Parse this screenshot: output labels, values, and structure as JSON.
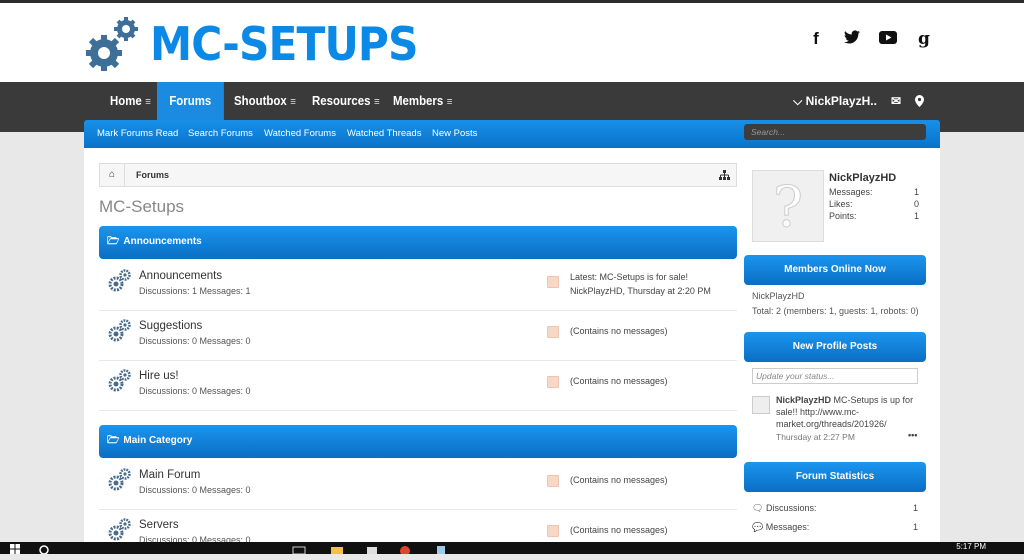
{
  "site": {
    "logo_text": "MC-SETUPS",
    "social_icons": [
      "facebook-icon",
      "twitter-icon",
      "youtube-icon",
      "google-plus-icon"
    ],
    "brand_color": "#0a8ae6"
  },
  "nav": {
    "items": [
      {
        "label": "Home",
        "active": false
      },
      {
        "label": "Forums",
        "active": true
      },
      {
        "label": "Shoutbox",
        "active": false
      },
      {
        "label": "Resources",
        "active": false
      },
      {
        "label": "Members",
        "active": false
      }
    ],
    "user": "NickPlayzH.."
  },
  "subnav": {
    "links": [
      "Mark Forums Read",
      "Search Forums",
      "Watched Forums",
      "Watched Threads",
      "New Posts"
    ],
    "search_placeholder": "Search..."
  },
  "breadcrumb": {
    "item": "Forums"
  },
  "page_title": "MC-Setups",
  "categories": [
    {
      "title": "Announcements",
      "forums": [
        {
          "title": "Announcements",
          "stats": "Discussions: 1 Messages: 1",
          "last_line1": "Latest: MC-Setups is for sale!",
          "last_line2": "NickPlayzHD, Thursday at 2:20 PM"
        },
        {
          "title": "Suggestions",
          "stats": "Discussions: 0 Messages: 0",
          "last_line1": "(Contains no messages)",
          "last_line2": ""
        },
        {
          "title": "Hire us!",
          "stats": "Discussions: 0 Messages: 0",
          "last_line1": "(Contains no messages)",
          "last_line2": ""
        }
      ]
    },
    {
      "title": "Main Category",
      "forums": [
        {
          "title": "Main Forum",
          "stats": "Discussions: 0 Messages: 0",
          "last_line1": "(Contains no messages)",
          "last_line2": ""
        },
        {
          "title": "Servers",
          "stats": "Discussions: 0 Messages: 0",
          "last_line1": "(Contains no messages)",
          "last_line2": ""
        }
      ]
    }
  ],
  "sidebar": {
    "profile": {
      "name": "NickPlayzHD",
      "stats": [
        {
          "label": "Messages:",
          "value": "1"
        },
        {
          "label": "Likes:",
          "value": "0"
        },
        {
          "label": "Points:",
          "value": "1"
        }
      ]
    },
    "members_online": {
      "title": "Members Online Now",
      "user": "NickPlayzHD",
      "total": "Total: 2 (members: 1, guests: 1, robots: 0)"
    },
    "profile_posts": {
      "title": "New Profile Posts",
      "status_placeholder": "Update your status...",
      "post_author": "NickPlayzHD",
      "post_text": " MC-Setups is up for sale!! http://www.mc-market.org/threads/201926/",
      "post_time": "Thursday at 2:27 PM",
      "more": "•••"
    },
    "forum_stats": {
      "title": "Forum Statistics",
      "rows": [
        {
          "label": "Discussions:",
          "value": "1"
        },
        {
          "label": "Messages:",
          "value": "1"
        }
      ]
    }
  },
  "taskbar": {
    "time": "5:17 PM"
  }
}
